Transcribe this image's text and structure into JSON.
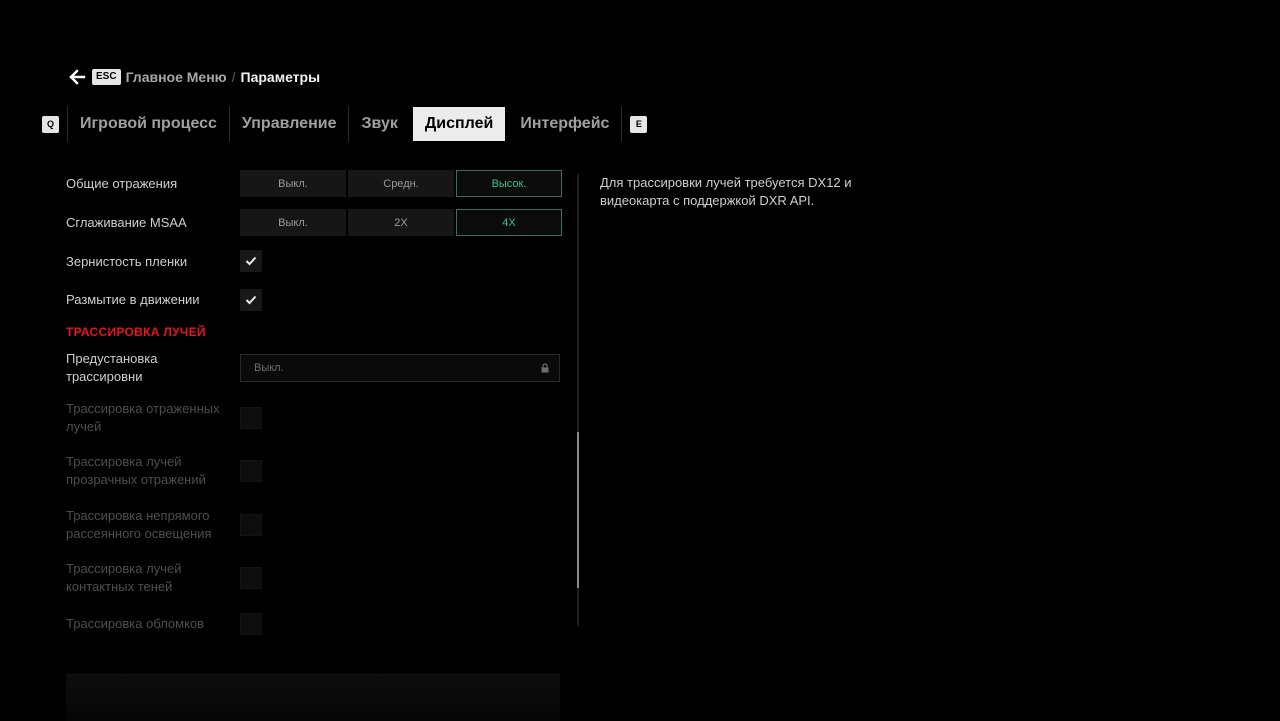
{
  "breadcrumb": {
    "esc_key": "ESC",
    "main_menu": "Главное Меню",
    "separator": "/",
    "current": "Параметры"
  },
  "tabs": {
    "prev_key": "Q",
    "next_key": "E",
    "items": [
      {
        "label": "Игровой процесс",
        "active": false
      },
      {
        "label": "Управление",
        "active": false
      },
      {
        "label": "Звук",
        "active": false
      },
      {
        "label": "Дисплей",
        "active": true
      },
      {
        "label": "Интерфейс",
        "active": false
      }
    ]
  },
  "settings": {
    "reflections": {
      "label": "Общие отражения",
      "options": [
        "Выкл.",
        "Средн.",
        "Высок."
      ],
      "selected": "Высок."
    },
    "msaa": {
      "label": "Сглаживание MSAA",
      "options": [
        "Выкл.",
        "2X",
        "4X"
      ],
      "selected": "4X"
    },
    "film_grain": {
      "label": "Зернистость пленки",
      "checked": true
    },
    "motion_blur": {
      "label": "Размытие в движении",
      "checked": true
    },
    "raytracing_section": "ТРАССИРОВКА ЛУЧЕЙ",
    "rt_preset": {
      "label_line1": "Предустановка",
      "label_line2": "трассировни",
      "value": "Выкл.",
      "locked": true
    },
    "rt_reflections": {
      "label_line1": "Трассировка отраженных",
      "label_line2": "лучей",
      "checked": false,
      "disabled": true
    },
    "rt_transparent": {
      "label_line1": "Трассировка лучей",
      "label_line2": "прозрачных отражений",
      "checked": false,
      "disabled": true
    },
    "rt_gi": {
      "label_line1": "Трассировка непрямого",
      "label_line2": "рассеянного освещения",
      "checked": false,
      "disabled": true
    },
    "rt_contact_shadows": {
      "label_line1": "Трассировка лучей",
      "label_line2": "контактных теней",
      "checked": false,
      "disabled": true
    },
    "rt_debris": {
      "label": "Трассировка обломков",
      "checked": false,
      "disabled": true
    }
  },
  "description": {
    "line1": "Для трассировки лучей требуется DX12 и",
    "line2": "видеокарта с поддержкой DXR API."
  },
  "colors": {
    "accent_selected": "#32c58f",
    "section_red": "#e5161e",
    "active_tab_bg": "#ececec"
  }
}
